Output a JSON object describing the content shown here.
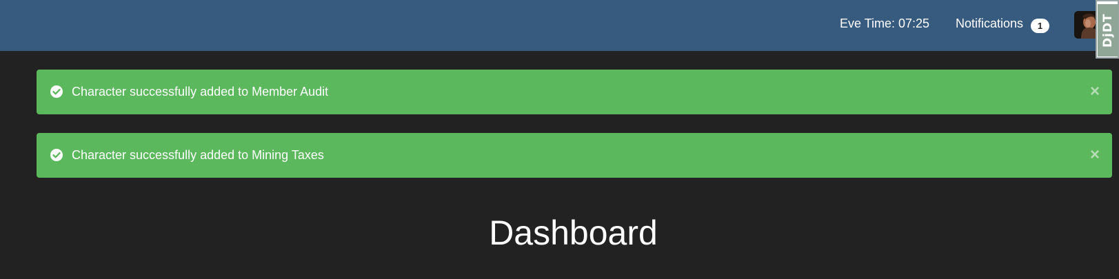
{
  "header": {
    "eve_time_label": "Eve Time: 07:25",
    "notifications_label": "Notifications",
    "notifications_count": "1",
    "debug_toolbar_label": "DjDT"
  },
  "alerts": [
    {
      "message": "Character successfully added to Member Audit",
      "icon": "check-circle-icon",
      "close": "×"
    },
    {
      "message": "Character successfully added to Mining Taxes",
      "icon": "check-circle-icon",
      "close": "×"
    }
  ],
  "main": {
    "title": "Dashboard"
  },
  "colors": {
    "navbar": "#375a7f",
    "background": "#222222",
    "success": "#5cb85c"
  }
}
